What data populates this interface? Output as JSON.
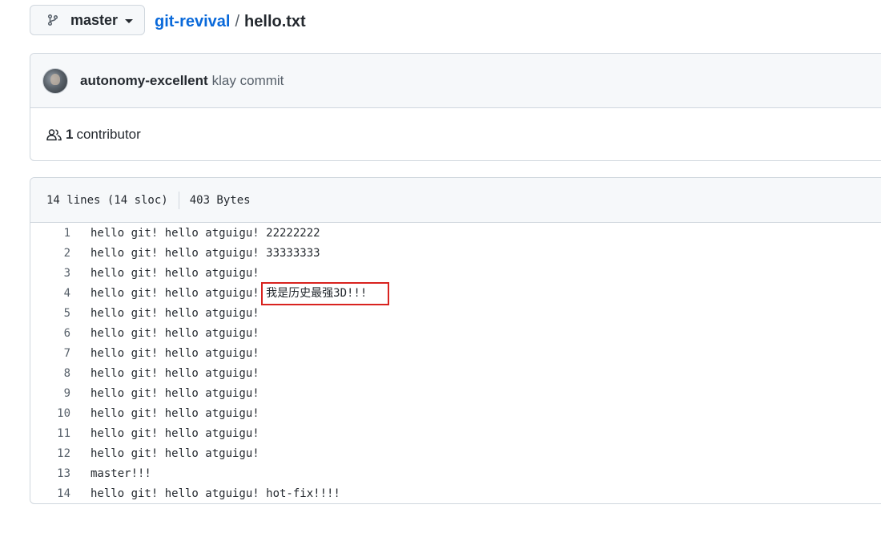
{
  "branch": {
    "name": "master"
  },
  "breadcrumb": {
    "repo": "git-revival",
    "separator": "/",
    "file": "hello.txt"
  },
  "commit": {
    "author": "autonomy-excellent",
    "message": "klay commit"
  },
  "contributors": {
    "count": "1",
    "label": "contributor"
  },
  "file_info": {
    "lines": "14 lines (14 sloc)",
    "size": "403 Bytes"
  },
  "code_lines": [
    {
      "num": "1",
      "text": "hello git! hello atguigu! 22222222"
    },
    {
      "num": "2",
      "text": "hello git! hello atguigu! 33333333"
    },
    {
      "num": "3",
      "text": "hello git! hello atguigu!"
    },
    {
      "num": "4",
      "text": "hello git! hello atguigu! 我是历史最强3D!!!"
    },
    {
      "num": "5",
      "text": "hello git! hello atguigu!"
    },
    {
      "num": "6",
      "text": "hello git! hello atguigu!"
    },
    {
      "num": "7",
      "text": "hello git! hello atguigu!"
    },
    {
      "num": "8",
      "text": "hello git! hello atguigu!"
    },
    {
      "num": "9",
      "text": "hello git! hello atguigu!"
    },
    {
      "num": "10",
      "text": "hello git! hello atguigu!"
    },
    {
      "num": "11",
      "text": "hello git! hello atguigu!"
    },
    {
      "num": "12",
      "text": "hello git! hello atguigu!"
    },
    {
      "num": "13",
      "text": "master!!!"
    },
    {
      "num": "14",
      "text": "hello git! hello atguigu! hot-fix!!!!"
    }
  ],
  "highlight": {
    "line": 4,
    "color": "#d9231f"
  },
  "colors": {
    "link": "#0969da",
    "border": "#d0d7de",
    "header_bg": "#f6f8fa",
    "muted": "#57606a"
  },
  "icons": {
    "branch": "git-branch-icon",
    "caret": "caret-down-icon",
    "people": "people-icon",
    "avatar": "avatar"
  }
}
